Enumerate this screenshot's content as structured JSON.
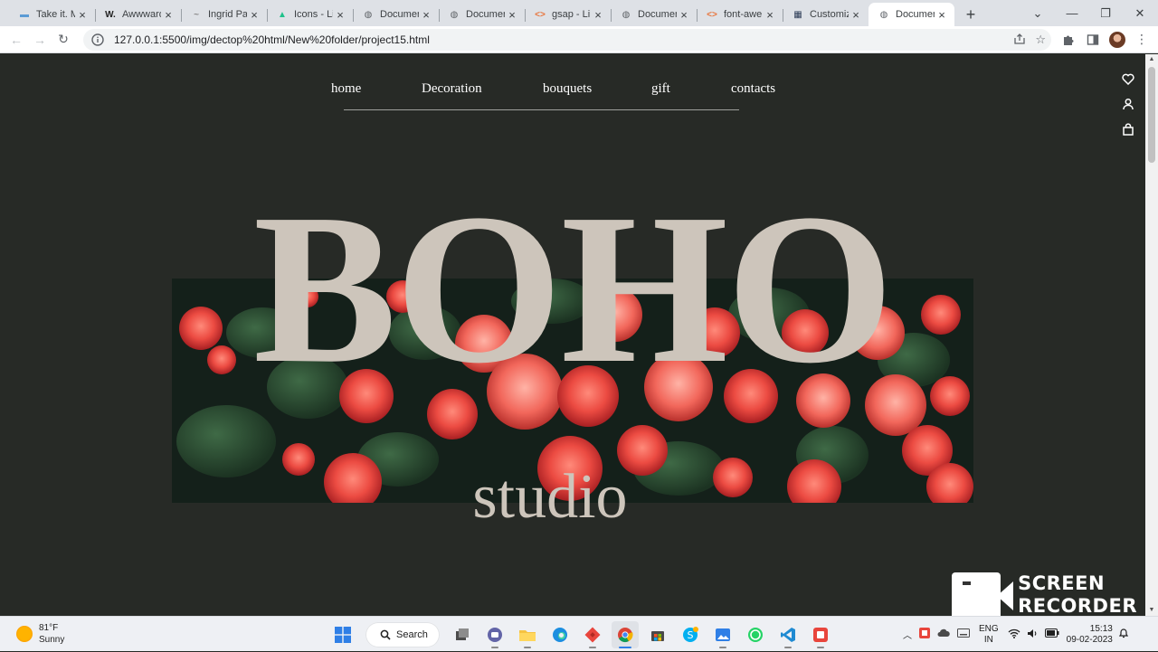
{
  "browser": {
    "tabs": [
      {
        "label": "Take it. M",
        "favicon": "#5b9bd5",
        "glyph": "▬",
        "active": false
      },
      {
        "label": "Awwward",
        "favicon": "#222222",
        "glyph": "W.",
        "active": false
      },
      {
        "label": "Ingrid Pa",
        "favicon": "#888888",
        "glyph": "~",
        "active": false
      },
      {
        "label": "Icons - Li",
        "favicon": "#1fc28b",
        "glyph": "▲",
        "active": false
      },
      {
        "label": "Documen",
        "favicon": "#5f6368",
        "glyph": "◍",
        "active": false
      },
      {
        "label": "Documen",
        "favicon": "#5f6368",
        "glyph": "◍",
        "active": false
      },
      {
        "label": "gsap - Lik",
        "favicon": "#e8743b",
        "glyph": "<>",
        "active": false
      },
      {
        "label": "Documen",
        "favicon": "#5f6368",
        "glyph": "◍",
        "active": false
      },
      {
        "label": "font-awe",
        "favicon": "#e8743b",
        "glyph": "<>",
        "active": false
      },
      {
        "label": "Customiz",
        "favicon": "#2b3a55",
        "glyph": "▦",
        "active": false
      },
      {
        "label": "Documen",
        "favicon": "#5f6368",
        "glyph": "◍",
        "active": true
      }
    ],
    "url": "127.0.0.1:5500/img/dectop%20html/New%20folder/project15.html"
  },
  "page": {
    "nav": [
      {
        "label": "home"
      },
      {
        "label": "Decoration"
      },
      {
        "label": "bouquets"
      },
      {
        "label": "gift"
      },
      {
        "label": "contacts"
      }
    ],
    "hero": {
      "title": "BOHO",
      "subtitle": "studio"
    }
  },
  "overlay": {
    "recorder_line1": "SCREEN",
    "recorder_line2": "RECORDER"
  },
  "taskbar": {
    "weather_temp": "81°F",
    "weather_desc": "Sunny",
    "search_label": "Search",
    "lang_line1": "ENG",
    "lang_line2": "IN",
    "time": "15:13",
    "date": "09-02-2023"
  },
  "colors": {
    "page_bg": "#272a26",
    "title_color": "#cdc5bb",
    "accent_flower": "#e8493f"
  }
}
